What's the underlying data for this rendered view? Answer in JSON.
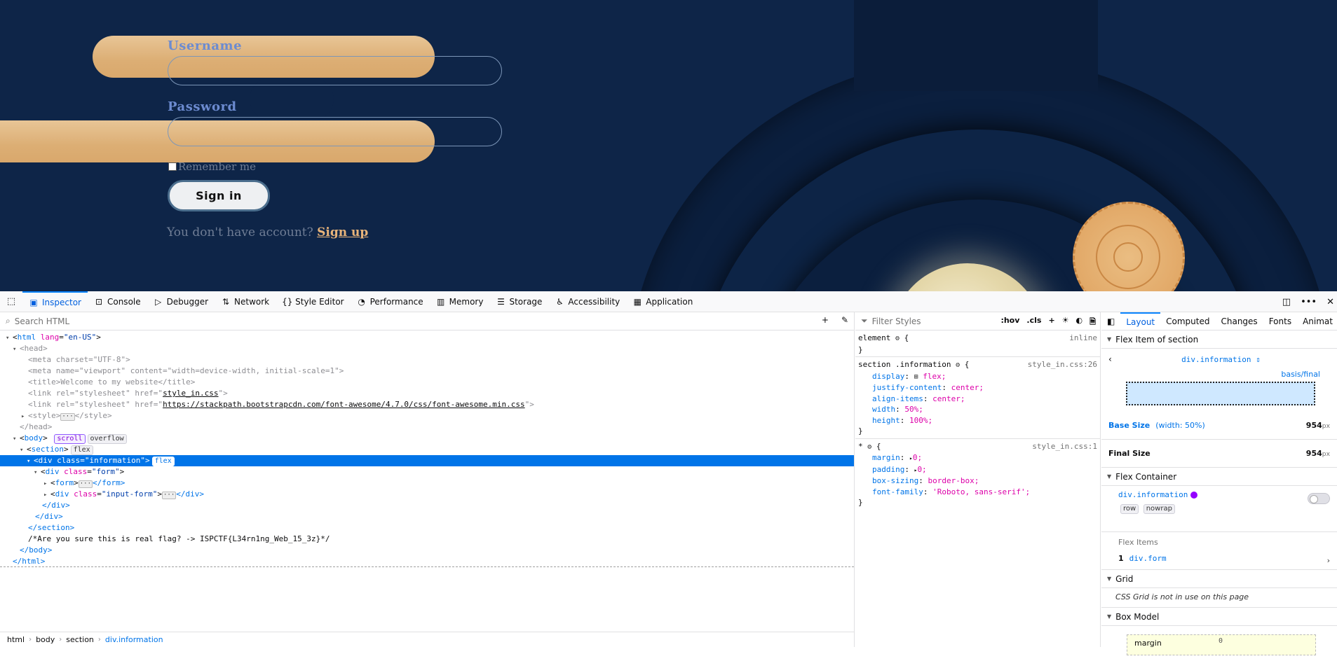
{
  "page": {
    "username_label": "Username",
    "password_label": "Password",
    "remember_label": "Remember me",
    "signin_label": "Sign in",
    "no_account_text": "You don't have account?",
    "signup_label": "Sign up",
    "colors": {
      "background": "#0e2548",
      "accent": "#e8b47a",
      "label": "#6c8bd0"
    }
  },
  "devtools": {
    "tabs": [
      {
        "label": "Inspector",
        "icon": "inspector-icon"
      },
      {
        "label": "Console",
        "icon": "console-icon"
      },
      {
        "label": "Debugger",
        "icon": "debugger-icon"
      },
      {
        "label": "Network",
        "icon": "network-icon"
      },
      {
        "label": "Style Editor",
        "icon": "style-editor-icon"
      },
      {
        "label": "Performance",
        "icon": "performance-icon"
      },
      {
        "label": "Memory",
        "icon": "memory-icon"
      },
      {
        "label": "Storage",
        "icon": "storage-icon"
      },
      {
        "label": "Accessibility",
        "icon": "accessibility-icon"
      },
      {
        "label": "Application",
        "icon": "application-icon"
      }
    ],
    "search_placeholder": "Search HTML",
    "markup": {
      "html_open": "html",
      "lang_attr": "lang",
      "lang_val": "\"en-US\"",
      "head": "<head>",
      "meta_charset": "<meta charset=\"UTF-8\">",
      "meta_viewport": "<meta name=\"viewport\" content=\"width=device-width, initial-scale=1\">",
      "title": "<title>Welcome to my website</title>",
      "link_style_pre": "<link rel=\"stylesheet\" href=\"",
      "link_style_href": "style_in.css",
      "link_style_post": "\">",
      "link_fa_pre": "<link rel=\"stylesheet\" href=\"",
      "link_fa_href": "https://stackpath.bootstrapcdn.com/font-awesome/4.7.0/css/font-awesome.min.css",
      "link_fa_post": "\">",
      "style_open": "<style>",
      "style_close": "</style>",
      "head_close": "</head>",
      "body": "body",
      "badge_scroll": "scroll",
      "badge_overflow": "overflow",
      "section": "section",
      "badge_flex": "flex",
      "div_info_tag": "div",
      "div_info_attr": "class",
      "div_info_val": "\"information\"",
      "div_form_tag": "div",
      "div_form_attr": "class",
      "div_form_val": "\"form\"",
      "form_open": "form",
      "form_close": "</form>",
      "div_input_tag": "div",
      "div_input_attr": "class",
      "div_input_val": "\"input-form\"",
      "div_input_close": "</div>",
      "div_close": "</div>",
      "section_close": "</section>",
      "comment": "/*Are you sure this is real flag? -> ISPCTF{L34rn1ng_Web_15_3z}*/",
      "body_close": "</body>",
      "html_close": "</html>"
    },
    "breadcrumb": [
      "html",
      "body",
      "section",
      "div.information"
    ],
    "styles": {
      "filter_placeholder": "Filter Styles",
      "hov": ":hov",
      "cls": ".cls",
      "element_selector": "element",
      "element_source": "inline",
      "section_selector": "section .information",
      "section_source": "style_in.css:26",
      "section_props": [
        {
          "name": "display",
          "value": "flex;"
        },
        {
          "name": "justify-content",
          "value": "center;"
        },
        {
          "name": "align-items",
          "value": "center;"
        },
        {
          "name": "width",
          "value": "50%;"
        },
        {
          "name": "height",
          "value": "100%;"
        }
      ],
      "star_selector": "*",
      "star_source": "style_in.css:1",
      "star_props": [
        {
          "name": "margin",
          "value": "0;"
        },
        {
          "name": "padding",
          "value": "0;"
        },
        {
          "name": "box-sizing",
          "value": "border-box;"
        },
        {
          "name": "font-family",
          "value": "'Roboto, sans-serif';"
        }
      ]
    },
    "layout": {
      "tabs": [
        "Layout",
        "Computed",
        "Changes",
        "Fonts",
        "Animat"
      ],
      "flex_item_header": "Flex Item of section",
      "flex_item_element": "div.information",
      "basis_final": "basis/final",
      "base_size_label": "Base Size",
      "base_size_sub": "(width: 50%)",
      "base_size_value": "954",
      "final_size_label": "Final Size",
      "final_size_value": "954",
      "unit": "px",
      "flex_container_header": "Flex Container",
      "flex_container_element": "div.information",
      "chip_row": "row",
      "chip_nowrap": "nowrap",
      "flex_items_label": "Flex Items",
      "flex_item_index": "1",
      "flex_item_name": "div.form",
      "grid_header": "Grid",
      "grid_message": "CSS Grid is not in use on this page",
      "box_model_header": "Box Model",
      "margin_label": "margin",
      "margin_value": "0"
    }
  }
}
